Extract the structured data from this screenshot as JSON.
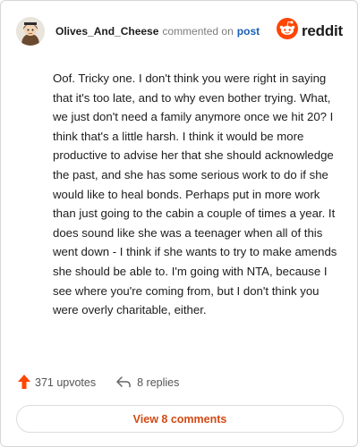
{
  "header": {
    "username": "Olives_And_Cheese",
    "commented_text": "commented on",
    "post_link": "post",
    "brand": "reddit"
  },
  "comment": {
    "text": "Oof. Tricky one. I don't think you were right in saying that it's too late, and to why even bother trying. What, we just don't need a family anymore once we hit 20? I think that's a little harsh. I think it would be more productive to advise her that she should acknowledge the past, and she has some serious work to do if she would like to heal bonds. Perhaps put in more work than just going to the cabin a couple of times a year. It does sound like she was a teenager when all of this went down - I think if she wants to try to make amends she should be able to. I'm going with NTA, because I see where you're coming from, but I don't think you were overly charitable, either."
  },
  "actions": {
    "upvotes": "371 upvotes",
    "replies": "8 replies"
  },
  "footer": {
    "view_comments": "View 8 comments"
  },
  "colors": {
    "accent": "#ff4500",
    "link": "#1a5fb4",
    "view_button_text": "#d24a14"
  },
  "icons": {
    "avatar": "avatar",
    "brand": "reddit-logo-icon",
    "upvote": "upvote-arrow-icon",
    "reply": "reply-arrow-icon"
  }
}
